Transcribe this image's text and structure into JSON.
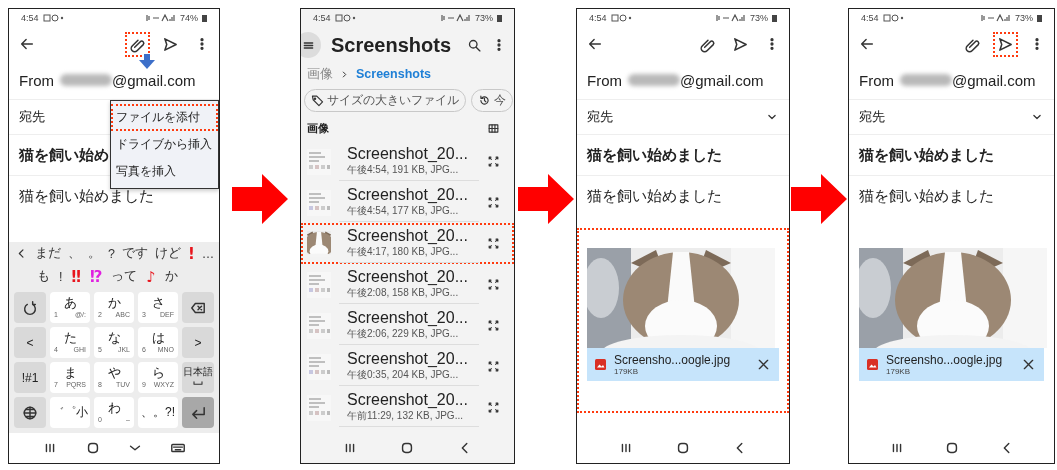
{
  "steps": [
    {
      "kind": "compose",
      "status_bar": {
        "time": "4:54",
        "battery": "74%"
      },
      "toolbar": [
        {
          "kind": "attach",
          "highlighted": true
        },
        {
          "kind": "send",
          "highlighted": false
        },
        {
          "kind": "more",
          "highlighted": false
        }
      ],
      "from": {
        "label": "From",
        "address": "@gmail.com"
      },
      "to_label": "宛先",
      "subject": "猫を飼い始め",
      "body": "猫を飼い始めました",
      "attach_menu": [
        {
          "label": "ファイルを添付",
          "highlighted": true
        },
        {
          "label": "ドライブから挿入",
          "highlighted": false
        },
        {
          "label": "写真を挿入",
          "highlighted": false
        }
      ],
      "keyboard": {
        "suggestions": [
          [
            {
              "text": "まだ"
            },
            {
              "text": "、"
            },
            {
              "text": "。"
            },
            {
              "text": "?"
            },
            {
              "text": "です"
            },
            {
              "text": "けど"
            },
            {
              "text": "!",
              "color": "#e8141c"
            },
            {
              "text": "…"
            }
          ],
          [
            {
              "text": "も"
            },
            {
              "text": "!"
            },
            {
              "text": "‼",
              "color": "#e8141c"
            },
            {
              "text": "⁉",
              "color": "#e020e0"
            },
            {
              "text": "って"
            },
            {
              "text": "♪",
              "color": "#e8141c"
            },
            {
              "text": "か"
            }
          ]
        ],
        "keys": [
          [
            {
              "kind": "undo"
            },
            {
              "kind": "kana",
              "main": "あ",
              "num": "1",
              "sub": "@/:"
            },
            {
              "kind": "kana",
              "main": "か",
              "num": "2",
              "sub": "ABC"
            },
            {
              "kind": "kana",
              "main": "さ",
              "num": "3",
              "sub": "DEF"
            },
            {
              "kind": "backspace"
            }
          ],
          [
            {
              "kind": "label",
              "label": "<"
            },
            {
              "kind": "kana",
              "main": "た",
              "num": "4",
              "sub": "GHI"
            },
            {
              "kind": "kana",
              "main": "な",
              "num": "5",
              "sub": "JKL"
            },
            {
              "kind": "kana",
              "main": "は",
              "num": "6",
              "sub": "MNO"
            },
            {
              "kind": "label",
              "label": ">"
            }
          ],
          [
            {
              "kind": "label",
              "label": "!#1"
            },
            {
              "kind": "kana",
              "main": "ま",
              "num": "7",
              "sub": "PQRS"
            },
            {
              "kind": "kana",
              "main": "や",
              "num": "8",
              "sub": "TUV"
            },
            {
              "kind": "kana",
              "main": "ら",
              "num": "9",
              "sub": "WXYZ"
            },
            {
              "kind": "space",
              "label": "日本語"
            }
          ],
          [
            {
              "kind": "globe"
            },
            {
              "kind": "light",
              "label": "゛゜小"
            },
            {
              "kind": "kana",
              "main": "わ",
              "num": "0",
              "sub": "–"
            },
            {
              "kind": "light",
              "label": "、。?!"
            },
            {
              "kind": "enter"
            }
          ]
        ]
      },
      "nav_bar": [
        {
          "kind": "recent"
        },
        {
          "kind": "home"
        },
        {
          "kind": "hide_keyboard"
        },
        {
          "kind": "keyboard"
        }
      ]
    },
    {
      "kind": "files",
      "status_bar": {
        "time": "4:54",
        "battery": "73%"
      },
      "title": "Screenshots",
      "breadcrumb": [
        {
          "label": "画像",
          "current": false
        },
        {
          "label": "Screenshots",
          "current": true
        }
      ],
      "chips": [
        {
          "kind": "tag",
          "label": "サイズの大きいファイル"
        },
        {
          "kind": "history",
          "label": "今"
        }
      ],
      "section": "画像",
      "files": [
        {
          "kind": "screenshot",
          "name": "Screenshot_20...",
          "meta": "午後4:54, 191 KB, JPG...",
          "highlighted": false
        },
        {
          "kind": "screenshot",
          "name": "Screenshot_20...",
          "meta": "午後4:54, 177 KB, JPG...",
          "highlighted": false
        },
        {
          "kind": "picture",
          "name": "Screenshot_20...",
          "meta": "午後4:17, 180 KB, JPG...",
          "highlighted": true
        },
        {
          "kind": "screenshot",
          "name": "Screenshot_20...",
          "meta": "午後2:08, 158 KB, JPG...",
          "highlighted": false
        },
        {
          "kind": "screenshot",
          "name": "Screenshot_20...",
          "meta": "午後2:06, 229 KB, JPG...",
          "highlighted": false
        },
        {
          "kind": "screenshot",
          "name": "Screenshot_20...",
          "meta": "午後0:35, 204 KB, JPG...",
          "highlighted": false
        },
        {
          "kind": "screenshot",
          "name": "Screenshot_20...",
          "meta": "午前11:29, 132 KB, JPG...",
          "highlighted": false
        }
      ],
      "nav_bar": [
        {
          "kind": "recent"
        },
        {
          "kind": "home"
        },
        {
          "kind": "back"
        }
      ]
    },
    {
      "kind": "compose",
      "status_bar": {
        "time": "4:54",
        "battery": "73%"
      },
      "toolbar": [
        {
          "kind": "attach",
          "highlighted": false
        },
        {
          "kind": "send",
          "highlighted": false
        },
        {
          "kind": "more",
          "highlighted": false
        }
      ],
      "from": {
        "label": "From",
        "address": "@gmail.com"
      },
      "to_label": "宛先",
      "to_expandable": true,
      "subject": "猫を飼い始めました",
      "body": "猫を飼い始めました",
      "attachment": {
        "name": "Screensho...oogle.jpg",
        "size": "179KB",
        "highlighted": true
      },
      "nav_bar": [
        {
          "kind": "recent"
        },
        {
          "kind": "home"
        },
        {
          "kind": "back"
        }
      ]
    },
    {
      "kind": "compose",
      "status_bar": {
        "time": "4:54",
        "battery": "73%"
      },
      "toolbar": [
        {
          "kind": "attach",
          "highlighted": false
        },
        {
          "kind": "send",
          "highlighted": true
        },
        {
          "kind": "more",
          "highlighted": false
        }
      ],
      "from": {
        "label": "From",
        "address": "@gmail.com"
      },
      "to_label": "宛先",
      "to_expandable": true,
      "subject": "猫を飼い始めました",
      "body": "猫を飼い始めました",
      "attachment": {
        "name": "Screensho...oogle.jpg",
        "size": "179KB",
        "highlighted": false
      },
      "nav_bar": [
        {
          "kind": "recent"
        },
        {
          "kind": "home"
        },
        {
          "kind": "back"
        }
      ]
    }
  ]
}
